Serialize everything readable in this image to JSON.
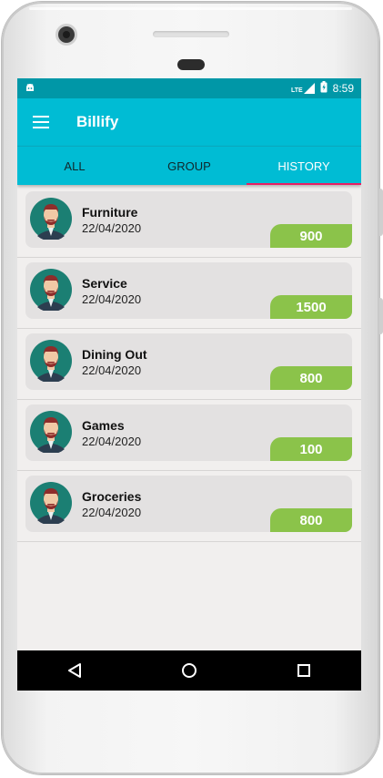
{
  "status_bar": {
    "time": "8:59",
    "network": "LTE",
    "left_icon": "android-debug-icon"
  },
  "app_bar": {
    "title": "Billify",
    "menu_icon": "hamburger-menu-icon"
  },
  "tabs": [
    {
      "label": "ALL",
      "active": false
    },
    {
      "label": "GROUP",
      "active": false
    },
    {
      "label": "HISTORY",
      "active": true
    }
  ],
  "history": [
    {
      "name": "Furniture",
      "date": "22/04/2020",
      "amount": "900"
    },
    {
      "name": "Service",
      "date": "22/04/2020",
      "amount": "1500"
    },
    {
      "name": "Dining Out",
      "date": "22/04/2020",
      "amount": "800"
    },
    {
      "name": "Games",
      "date": "22/04/2020",
      "amount": "100"
    },
    {
      "name": "Groceries",
      "date": "22/04/2020",
      "amount": "800"
    }
  ],
  "nav": {
    "back_icon": "back-triangle-icon",
    "home_icon": "home-circle-icon",
    "recents_icon": "recents-square-icon"
  },
  "colors": {
    "primary": "#00bcd4",
    "primary_dark": "#0097a7",
    "accent": "#e91e63",
    "amount_badge": "#8bc34a",
    "card": "#e3e1e1"
  }
}
